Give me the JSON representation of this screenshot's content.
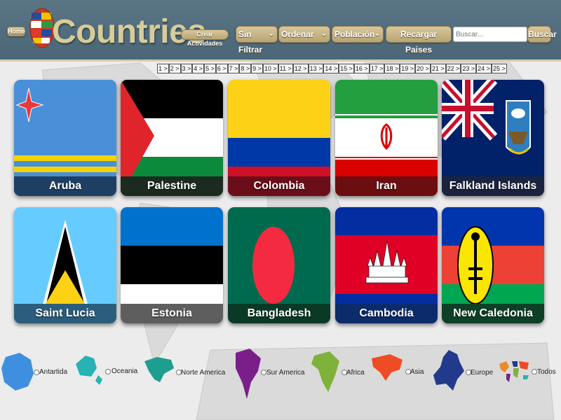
{
  "header": {
    "home_label": "Home",
    "title": "Countries",
    "create_label": "Crear Actividades",
    "filter_value": "Sin Filtrar",
    "order_value": "Ordenar",
    "population_value": "Población",
    "reload_label": "Recargar Paises",
    "search_placeholder": "Buscar...",
    "search_label": "Buscar"
  },
  "pagination": [
    "1",
    "2",
    "3",
    "4",
    "5",
    "6",
    "7",
    "8",
    "9",
    "10",
    "11",
    "12",
    "13",
    "14",
    "15",
    "16",
    "17",
    "18",
    "19",
    "20",
    "21",
    "22",
    "23",
    "24",
    "25"
  ],
  "countries": [
    {
      "name": "Aruba",
      "bar": "#1e3f63"
    },
    {
      "name": "Palestine",
      "bar": "#1b2b1f"
    },
    {
      "name": "Colombia",
      "bar": "#6a0e1a"
    },
    {
      "name": "Iran",
      "bar": "#6a0e10"
    },
    {
      "name": "Falkland Islands",
      "bar": "#1a2340"
    },
    {
      "name": "Saint Lucia",
      "bar": "#2c5d7c"
    },
    {
      "name": "Estonia",
      "bar": "#5e5e5e"
    },
    {
      "name": "Bangladesh",
      "bar": "#0a3a26"
    },
    {
      "name": "Cambodia",
      "bar": "#0c2b6b"
    },
    {
      "name": "New Caledonia",
      "bar": "#0d4025"
    }
  ],
  "continents": [
    {
      "label": "Antartida",
      "icon": "antarctica-icon",
      "color": "#3f8fe0"
    },
    {
      "label": "Oceania",
      "icon": "oceania-icon",
      "color": "#25b3b3"
    },
    {
      "label": "Norte America",
      "icon": "north-america-icon",
      "color": "#1d9e8e"
    },
    {
      "label": "Sur America",
      "icon": "south-america-icon",
      "color": "#7a1f8a"
    },
    {
      "label": "Africa",
      "icon": "africa-icon",
      "color": "#7fb23a"
    },
    {
      "label": "Asia",
      "icon": "asia-icon",
      "color": "#ef4b24"
    },
    {
      "label": "Europe",
      "icon": "europe-icon",
      "color": "#223a8c"
    },
    {
      "label": "Todos",
      "icon": "world-icon",
      "color": "#e88b2a"
    }
  ]
}
